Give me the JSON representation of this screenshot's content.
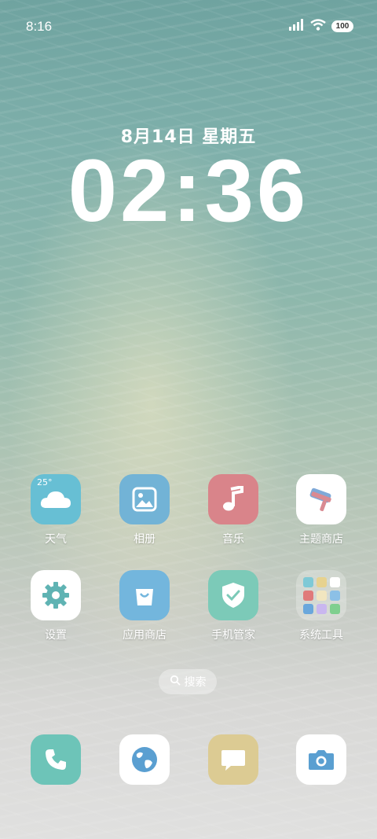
{
  "status_bar": {
    "time": "8:16",
    "battery": "100"
  },
  "lockscreen": {
    "date": "8月14日 星期五",
    "time": "02:36"
  },
  "apps_row1": [
    {
      "label": "天气",
      "icon": "weather-cloud-icon",
      "temp": "25°"
    },
    {
      "label": "相册",
      "icon": "gallery-icon"
    },
    {
      "label": "音乐",
      "icon": "music-note-icon"
    },
    {
      "label": "主题商店",
      "icon": "theme-brush-icon"
    }
  ],
  "apps_row2": [
    {
      "label": "设置",
      "icon": "gear-icon"
    },
    {
      "label": "应用商店",
      "icon": "shopping-bag-icon"
    },
    {
      "label": "手机管家",
      "icon": "shield-check-icon"
    },
    {
      "label": "系统工具",
      "icon": "folder-icon"
    }
  ],
  "search": {
    "label": "搜索"
  },
  "dock": [
    {
      "icon": "phone-icon"
    },
    {
      "icon": "browser-globe-icon"
    },
    {
      "icon": "messages-icon"
    },
    {
      "icon": "camera-icon"
    }
  ],
  "colors": {
    "weather": "#67bfd4",
    "gallery": "#72b3d6",
    "music": "#d9848a",
    "settings_icon": "#5fb3b3",
    "store": "#73b6dd",
    "manager": "#7ccab8",
    "phone": "#6dc4b8",
    "messages": "#dccb93",
    "camera_icon": "#5a9fd1"
  }
}
